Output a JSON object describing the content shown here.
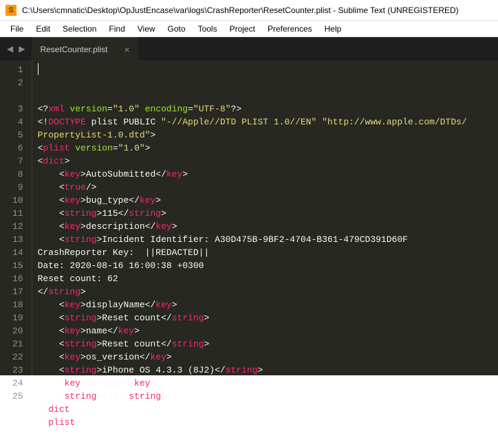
{
  "window": {
    "title": "C:\\Users\\cmnatic\\Desktop\\OpJustEncase\\var\\logs\\CrashReporter\\ResetCounter.plist - Sublime Text (UNREGISTERED)"
  },
  "menu": {
    "items": [
      "File",
      "Edit",
      "Selection",
      "Find",
      "View",
      "Goto",
      "Tools",
      "Project",
      "Preferences",
      "Help"
    ]
  },
  "tab": {
    "label": "ResetCounter.plist"
  },
  "code": {
    "lines": [
      {
        "num": "1",
        "tokens": [
          {
            "t": "<?",
            "c": "c-txt"
          },
          {
            "t": "xml",
            "c": "c-tag"
          },
          {
            "t": " version",
            "c": "c-attr"
          },
          {
            "t": "=",
            "c": "c-txt"
          },
          {
            "t": "\"1.0\"",
            "c": "c-str"
          },
          {
            "t": " encoding",
            "c": "c-attr"
          },
          {
            "t": "=",
            "c": "c-txt"
          },
          {
            "t": "\"UTF-8\"",
            "c": "c-str"
          },
          {
            "t": "?>",
            "c": "c-txt"
          }
        ]
      },
      {
        "num": "2",
        "tokens": [
          {
            "t": "<!",
            "c": "c-txt"
          },
          {
            "t": "DOCTYPE",
            "c": "c-tag"
          },
          {
            "t": " plist PUBLIC ",
            "c": "c-txt"
          },
          {
            "t": "\"-//Apple//DTD PLIST 1.0//EN\"",
            "c": "c-str"
          },
          {
            "t": " ",
            "c": "c-txt"
          },
          {
            "t": "\"http://www.apple.com/DTDs/",
            "c": "c-str"
          }
        ]
      },
      {
        "num": "",
        "tokens": [
          {
            "t": "PropertyList-1.0.dtd\"",
            "c": "c-str"
          },
          {
            "t": ">",
            "c": "c-txt"
          }
        ]
      },
      {
        "num": "3",
        "tokens": [
          {
            "t": "<",
            "c": "c-txt"
          },
          {
            "t": "plist",
            "c": "c-tag"
          },
          {
            "t": " version",
            "c": "c-attr"
          },
          {
            "t": "=",
            "c": "c-txt"
          },
          {
            "t": "\"1.0\"",
            "c": "c-str"
          },
          {
            "t": ">",
            "c": "c-txt"
          }
        ]
      },
      {
        "num": "4",
        "tokens": [
          {
            "t": "<",
            "c": "c-txt"
          },
          {
            "t": "dict",
            "c": "c-tag"
          },
          {
            "t": ">",
            "c": "c-txt"
          }
        ]
      },
      {
        "num": "5",
        "tokens": [
          {
            "t": "    <",
            "c": "c-txt"
          },
          {
            "t": "key",
            "c": "c-tag"
          },
          {
            "t": ">",
            "c": "c-txt"
          },
          {
            "t": "AutoSubmitted",
            "c": "c-txt"
          },
          {
            "t": "</",
            "c": "c-txt"
          },
          {
            "t": "key",
            "c": "c-tag"
          },
          {
            "t": ">",
            "c": "c-txt"
          }
        ]
      },
      {
        "num": "6",
        "tokens": [
          {
            "t": "    <",
            "c": "c-txt"
          },
          {
            "t": "true",
            "c": "c-tag"
          },
          {
            "t": "/>",
            "c": "c-txt"
          }
        ]
      },
      {
        "num": "7",
        "tokens": [
          {
            "t": "    <",
            "c": "c-txt"
          },
          {
            "t": "key",
            "c": "c-tag"
          },
          {
            "t": ">",
            "c": "c-txt"
          },
          {
            "t": "bug_type",
            "c": "c-txt"
          },
          {
            "t": "</",
            "c": "c-txt"
          },
          {
            "t": "key",
            "c": "c-tag"
          },
          {
            "t": ">",
            "c": "c-txt"
          }
        ]
      },
      {
        "num": "8",
        "tokens": [
          {
            "t": "    <",
            "c": "c-txt"
          },
          {
            "t": "string",
            "c": "c-tag"
          },
          {
            "t": ">",
            "c": "c-txt"
          },
          {
            "t": "115",
            "c": "c-txt"
          },
          {
            "t": "</",
            "c": "c-txt"
          },
          {
            "t": "string",
            "c": "c-tag"
          },
          {
            "t": ">",
            "c": "c-txt"
          }
        ]
      },
      {
        "num": "9",
        "tokens": [
          {
            "t": "    <",
            "c": "c-txt"
          },
          {
            "t": "key",
            "c": "c-tag"
          },
          {
            "t": ">",
            "c": "c-txt"
          },
          {
            "t": "description",
            "c": "c-txt"
          },
          {
            "t": "</",
            "c": "c-txt"
          },
          {
            "t": "key",
            "c": "c-tag"
          },
          {
            "t": ">",
            "c": "c-txt"
          }
        ]
      },
      {
        "num": "10",
        "tokens": [
          {
            "t": "    <",
            "c": "c-txt"
          },
          {
            "t": "string",
            "c": "c-tag"
          },
          {
            "t": ">",
            "c": "c-txt"
          },
          {
            "t": "Incident Identifier: A30D475B-9BF2-4704-B361-479CD391D60F",
            "c": "c-txt"
          }
        ]
      },
      {
        "num": "11",
        "tokens": [
          {
            "t": "CrashReporter Key:  ||REDACTED||",
            "c": "c-txt"
          }
        ]
      },
      {
        "num": "12",
        "tokens": [
          {
            "t": "Date: 2020-08-16 16:00:38 +0300",
            "c": "c-txt"
          }
        ]
      },
      {
        "num": "13",
        "tokens": [
          {
            "t": "Reset count: 62",
            "c": "c-txt"
          }
        ]
      },
      {
        "num": "14",
        "tokens": [
          {
            "t": "</",
            "c": "c-txt"
          },
          {
            "t": "string",
            "c": "c-tag"
          },
          {
            "t": ">",
            "c": "c-txt"
          }
        ]
      },
      {
        "num": "15",
        "tokens": [
          {
            "t": "    <",
            "c": "c-txt"
          },
          {
            "t": "key",
            "c": "c-tag"
          },
          {
            "t": ">",
            "c": "c-txt"
          },
          {
            "t": "displayName",
            "c": "c-txt"
          },
          {
            "t": "</",
            "c": "c-txt"
          },
          {
            "t": "key",
            "c": "c-tag"
          },
          {
            "t": ">",
            "c": "c-txt"
          }
        ]
      },
      {
        "num": "16",
        "tokens": [
          {
            "t": "    <",
            "c": "c-txt"
          },
          {
            "t": "string",
            "c": "c-tag"
          },
          {
            "t": ">",
            "c": "c-txt"
          },
          {
            "t": "Reset count",
            "c": "c-txt"
          },
          {
            "t": "</",
            "c": "c-txt"
          },
          {
            "t": "string",
            "c": "c-tag"
          },
          {
            "t": ">",
            "c": "c-txt"
          }
        ]
      },
      {
        "num": "17",
        "tokens": [
          {
            "t": "    <",
            "c": "c-txt"
          },
          {
            "t": "key",
            "c": "c-tag"
          },
          {
            "t": ">",
            "c": "c-txt"
          },
          {
            "t": "name",
            "c": "c-txt"
          },
          {
            "t": "</",
            "c": "c-txt"
          },
          {
            "t": "key",
            "c": "c-tag"
          },
          {
            "t": ">",
            "c": "c-txt"
          }
        ]
      },
      {
        "num": "18",
        "tokens": [
          {
            "t": "    <",
            "c": "c-txt"
          },
          {
            "t": "string",
            "c": "c-tag"
          },
          {
            "t": ">",
            "c": "c-txt"
          },
          {
            "t": "Reset count",
            "c": "c-txt"
          },
          {
            "t": "</",
            "c": "c-txt"
          },
          {
            "t": "string",
            "c": "c-tag"
          },
          {
            "t": ">",
            "c": "c-txt"
          }
        ]
      },
      {
        "num": "19",
        "tokens": [
          {
            "t": "    <",
            "c": "c-txt"
          },
          {
            "t": "key",
            "c": "c-tag"
          },
          {
            "t": ">",
            "c": "c-txt"
          },
          {
            "t": "os_version",
            "c": "c-txt"
          },
          {
            "t": "</",
            "c": "c-txt"
          },
          {
            "t": "key",
            "c": "c-tag"
          },
          {
            "t": ">",
            "c": "c-txt"
          }
        ]
      },
      {
        "num": "20",
        "tokens": [
          {
            "t": "    <",
            "c": "c-txt"
          },
          {
            "t": "string",
            "c": "c-tag"
          },
          {
            "t": ">",
            "c": "c-txt"
          },
          {
            "t": "iPhone OS 4.3.3 (8J2)",
            "c": "c-txt"
          },
          {
            "t": "</",
            "c": "c-txt"
          },
          {
            "t": "string",
            "c": "c-tag"
          },
          {
            "t": ">",
            "c": "c-txt"
          }
        ]
      },
      {
        "num": "21",
        "tokens": [
          {
            "t": "    <",
            "c": "c-txt"
          },
          {
            "t": "key",
            "c": "c-tag"
          },
          {
            "t": ">",
            "c": "c-txt"
          },
          {
            "t": "version",
            "c": "c-txt"
          },
          {
            "t": "</",
            "c": "c-txt"
          },
          {
            "t": "key",
            "c": "c-tag"
          },
          {
            "t": ">",
            "c": "c-txt"
          }
        ]
      },
      {
        "num": "22",
        "tokens": [
          {
            "t": "    <",
            "c": "c-txt"
          },
          {
            "t": "string",
            "c": "c-tag"
          },
          {
            "t": ">",
            "c": "c-txt"
          },
          {
            "t": "101",
            "c": "c-txt"
          },
          {
            "t": "</",
            "c": "c-txt"
          },
          {
            "t": "string",
            "c": "c-tag"
          },
          {
            "t": ">",
            "c": "c-txt"
          }
        ]
      },
      {
        "num": "23",
        "tokens": [
          {
            "t": "</",
            "c": "c-txt"
          },
          {
            "t": "dict",
            "c": "c-tag"
          },
          {
            "t": ">",
            "c": "c-txt"
          }
        ]
      },
      {
        "num": "24",
        "tokens": [
          {
            "t": "</",
            "c": "c-txt"
          },
          {
            "t": "plist",
            "c": "c-tag"
          },
          {
            "t": ">",
            "c": "c-txt"
          }
        ]
      },
      {
        "num": "25",
        "tokens": []
      }
    ]
  }
}
